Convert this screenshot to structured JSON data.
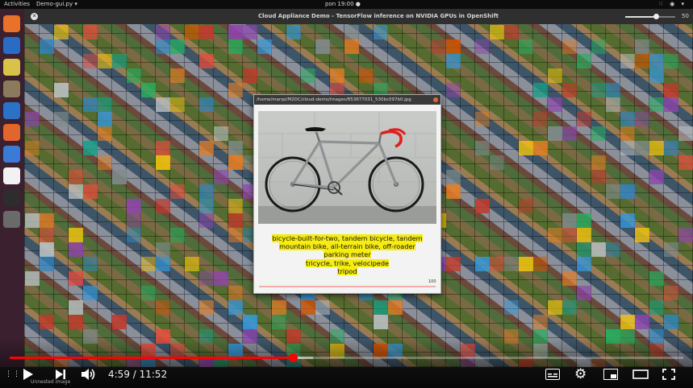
{
  "topbar": {
    "activities": "Activities",
    "app_menu": "Demo-gui.py ▾",
    "clock": "pon 19:00 ●",
    "tray": "⁙ ◉ ▾"
  },
  "window": {
    "title": "Cloud Appliance Demo - TensorFlow inference on NVIDIA GPUs in OpenShift",
    "slider_value": "50",
    "slider_fraction": 0.62
  },
  "dock": {
    "items": [
      {
        "name": "firefox",
        "color": "#e8712c"
      },
      {
        "name": "thunderbird",
        "color": "#2a6cc4"
      },
      {
        "name": "rhythmbox",
        "color": "#d9c24a"
      },
      {
        "name": "files",
        "color": "#8c7a5c"
      },
      {
        "name": "libreoffice-writer",
        "color": "#2a72c8"
      },
      {
        "name": "software-center",
        "color": "#e2662b"
      },
      {
        "name": "help",
        "color": "#3a7bd5"
      },
      {
        "name": "amazon",
        "color": "#f2f2f2"
      },
      {
        "name": "terminal",
        "color": "#2d2d2d"
      },
      {
        "name": "demo-app",
        "color": "#6a6a6a"
      }
    ]
  },
  "popup": {
    "title": "/home/marqs/M2DC/cloud-demo/images/853677031_530bc097b0.jpg",
    "labels": [
      "bicycle-built-for-two, tandem bicycle, tandem",
      "mountain bike, all-terrain bike, off-roader",
      "parking meter",
      "tricycle, trike, velocipede",
      "tripod"
    ],
    "progress_value": "100",
    "progress_fraction": 1.0,
    "accent": "#f6ec12"
  },
  "player": {
    "time": "4:59 / 11:52",
    "played_fraction": 0.42,
    "buffered_fraction": 0.45,
    "overlay_label": "Unnested image",
    "progress_color": "#ff0000"
  }
}
